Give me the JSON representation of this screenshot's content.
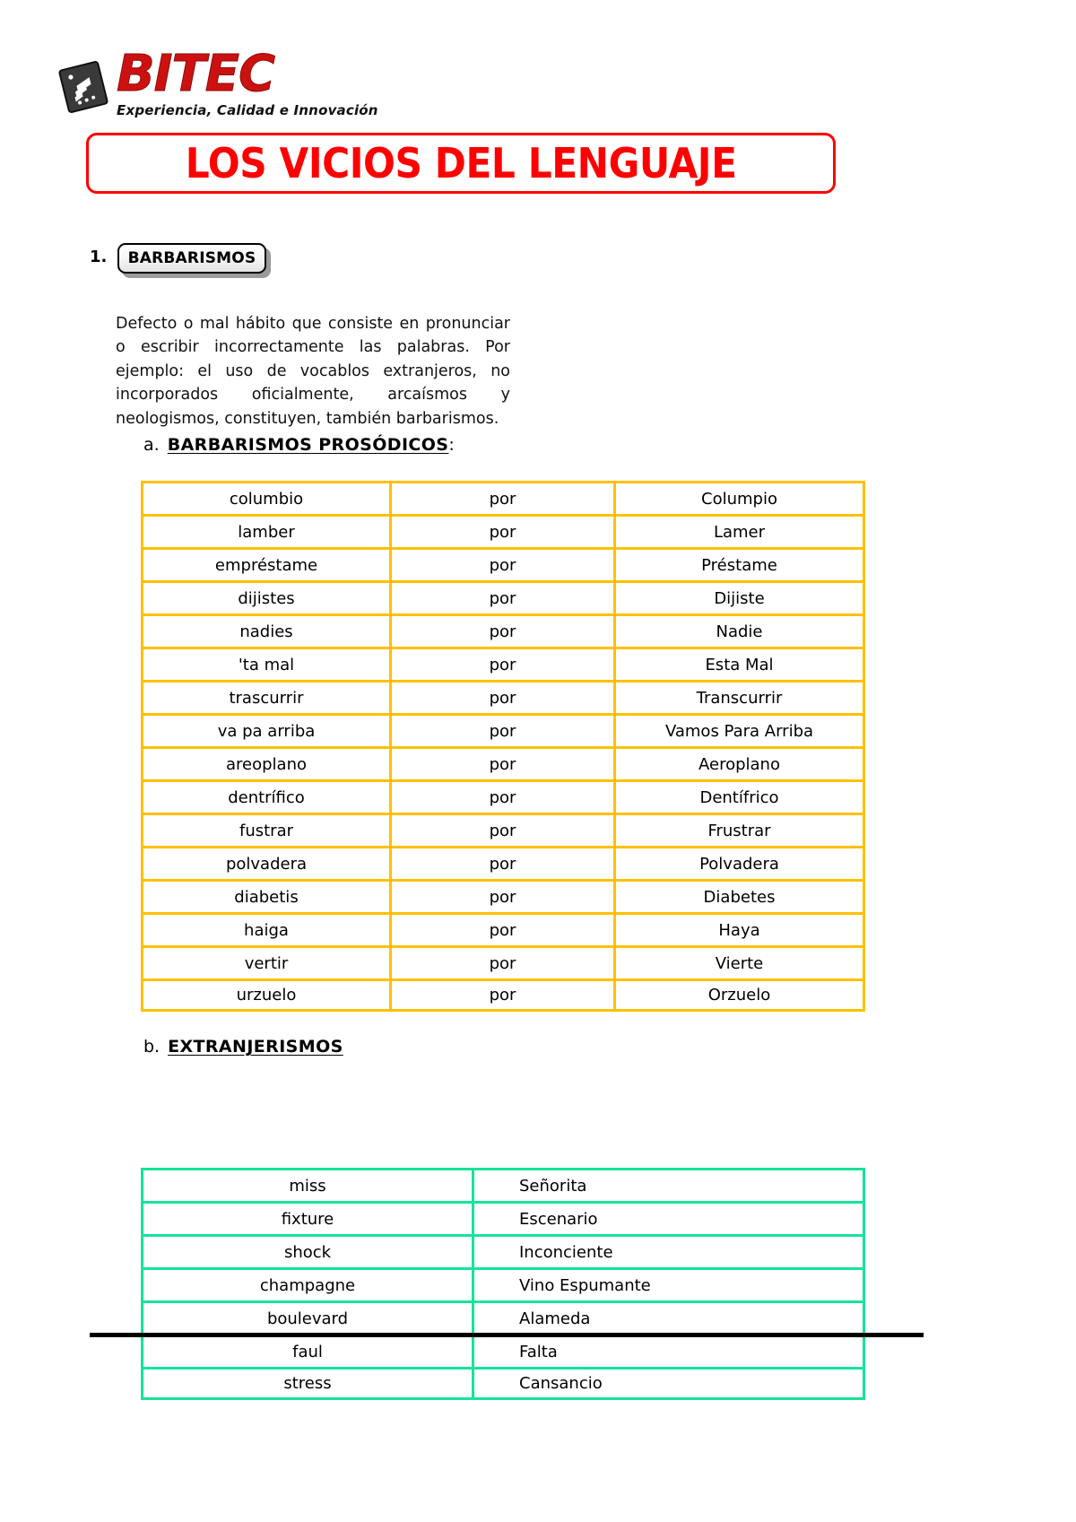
{
  "logo": {
    "mark_icon": "bitec-cube-icon",
    "word": "BITEC",
    "tagline": "Experiencia, Calidad e Innovación"
  },
  "title": {
    "text": "LOS VICIOS DEL LENGUAJE",
    "color": "#ff0000"
  },
  "section": {
    "number": "1.",
    "badge_label": "BARBARISMOS",
    "definition": "Defecto o mal hábito que consiste en pronunciar o escribir incorrectamente las palabras. Por ejemplo: el uso de vocablos extranjeros, no incorporados oficialmente, arcaísmos y neologismos, constituyen, también barbarismos."
  },
  "subsections": [
    {
      "letter": "a.",
      "heading": "BARBARISMOS PROSÓDICOS",
      "suffix": ":",
      "table_border_color": "#ffc000"
    },
    {
      "letter": "b.",
      "heading": "EXTRANJERISMOS",
      "suffix": "",
      "table_border_color": "#14e49a"
    }
  ],
  "prosodicos_table": {
    "rows": [
      {
        "wrong": "columbio",
        "por": "por",
        "correct": "Columpio"
      },
      {
        "wrong": "lamber",
        "por": "por",
        "correct": "Lamer"
      },
      {
        "wrong": "empréstame",
        "por": "por",
        "correct": "Préstame"
      },
      {
        "wrong": "dijistes",
        "por": "por",
        "correct": "Dijiste"
      },
      {
        "wrong": "nadies",
        "por": "por",
        "correct": "Nadie"
      },
      {
        "wrong": "'ta mal",
        "por": "por",
        "correct": "Esta Mal"
      },
      {
        "wrong": "trascurrir",
        "por": "por",
        "correct": "Transcurrir"
      },
      {
        "wrong": "va pa arriba",
        "por": "por",
        "correct": "Vamos Para Arriba"
      },
      {
        "wrong": "areoplano",
        "por": "por",
        "correct": "Aeroplano"
      },
      {
        "wrong": "dentrífico",
        "por": "por",
        "correct": "Dentífrico"
      },
      {
        "wrong": "fustrar",
        "por": "por",
        "correct": "Frustrar"
      },
      {
        "wrong": "polvadera",
        "por": "por",
        "correct": "Polvadera"
      },
      {
        "wrong": "diabetis",
        "por": "por",
        "correct": "Diabetes"
      },
      {
        "wrong": "haiga",
        "por": "por",
        "correct": "Haya"
      },
      {
        "wrong": "vertir",
        "por": "por",
        "correct": "Vierte"
      },
      {
        "wrong": "urzuelo",
        "por": "por",
        "correct": "Orzuelo"
      }
    ]
  },
  "extranjerismos_table": {
    "rows": [
      {
        "foreign": "miss",
        "spanish": "Señorita"
      },
      {
        "foreign": "fixture",
        "spanish": "Escenario"
      },
      {
        "foreign": "shock",
        "spanish": "Inconciente"
      },
      {
        "foreign": "champagne",
        "spanish": "Vino Espumante"
      },
      {
        "foreign": "boulevard",
        "spanish": "Alameda"
      },
      {
        "foreign": "faul",
        "spanish": "Falta"
      },
      {
        "foreign": "stress",
        "spanish": "Cansancio"
      }
    ]
  }
}
